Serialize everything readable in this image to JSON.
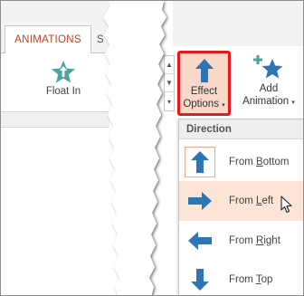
{
  "ribbon": {
    "active_tab": "ANIMATIONS",
    "next_tab_fragment": "S",
    "gallery": {
      "label": "Float In"
    },
    "effect_options": {
      "line1": "Effect",
      "line2": "Options",
      "caret": "▾"
    },
    "add_animation": {
      "line1": "Add",
      "line2": "Animation",
      "caret": "▾"
    },
    "scroll": {
      "up": "▲",
      "down": "▼",
      "more": "▾"
    }
  },
  "dropdown": {
    "header": "Direction",
    "items": [
      {
        "pre": "From ",
        "key": "B",
        "post": "ottom",
        "icon": "arrow-up-icon",
        "state": "current"
      },
      {
        "pre": "From ",
        "key": "L",
        "post": "eft",
        "icon": "arrow-right-icon",
        "state": "hover"
      },
      {
        "pre": "From ",
        "key": "R",
        "post": "ight",
        "icon": "arrow-left-icon",
        "state": ""
      },
      {
        "pre": "From ",
        "key": "T",
        "post": "op",
        "icon": "arrow-down-icon",
        "state": ""
      }
    ]
  },
  "colors": {
    "accent_orange": "#c43e1c",
    "highlight_red": "#e8171c",
    "arrow_blue": "#2e75b6",
    "star_teal": "#4aa59e",
    "hover_bg": "#fce4d6"
  }
}
